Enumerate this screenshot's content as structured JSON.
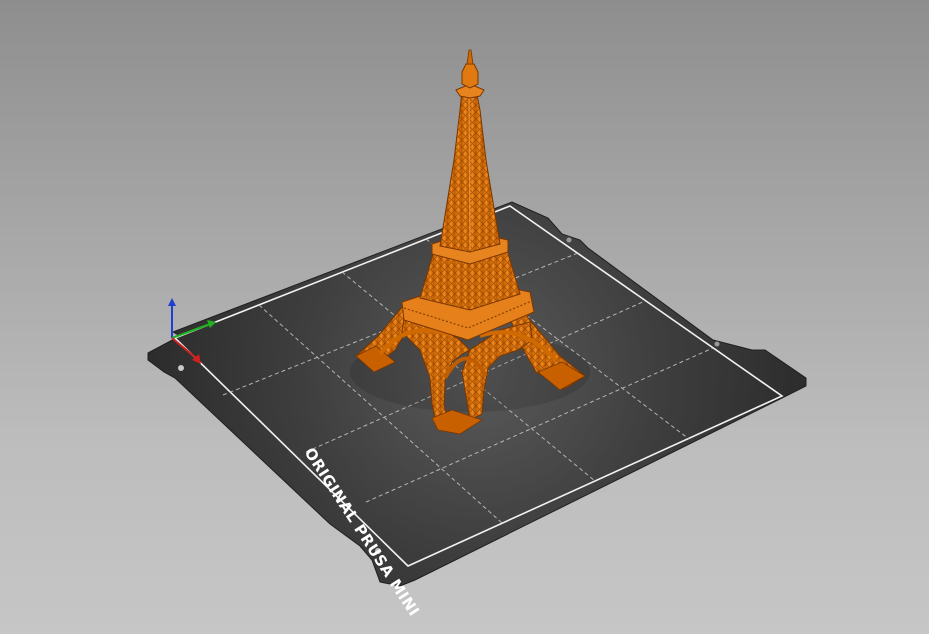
{
  "app": {
    "view": "3D plater viewport"
  },
  "bed": {
    "label": "ORIGINAL PRUSA MINI",
    "surface_color": "#3c3c3c",
    "border_color": "#ffffff",
    "grid_color": "#c8c8c8"
  },
  "model": {
    "color": "#e07a10"
  },
  "axes": {
    "x_color": "#d02020",
    "y_color": "#20b020",
    "z_color": "#1f3fd0"
  }
}
